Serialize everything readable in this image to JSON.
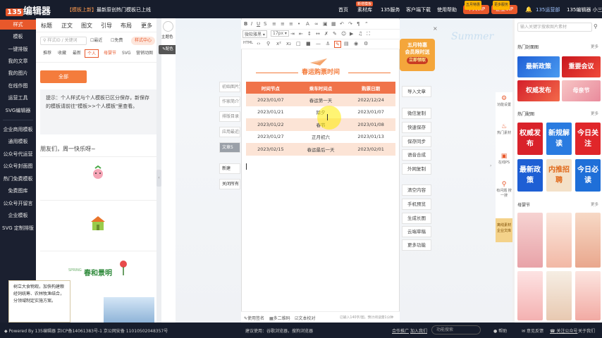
{
  "topbar": {
    "logo": "编辑器",
    "logo_prefix": "135",
    "notice_tag": "【模板上新】",
    "notice_text": "最新原创热门模板已上线",
    "nav": [
      "首页",
      "素材库",
      "135服务",
      "客户端下载",
      "使用帮助"
    ],
    "nav_badge": "新增模板",
    "vip_personal": "个人VIP",
    "vip_personal_tag": "五月特惠",
    "vip_enterprise": "企业VIP",
    "vip_enterprise_tag": "更多服务",
    "user_links": [
      "135运营部",
      "135编辑器 小三儿"
    ]
  },
  "leftnav": {
    "items": [
      "样式",
      "模板",
      "一键排版",
      "我的文章",
      "我的图片",
      "在线作图",
      "运营工具",
      "SVG编辑器",
      "企业商用模板",
      "通用模板",
      "公众号代运营",
      "公众号封面图",
      "热门免费模板",
      "免费图库",
      "公众号开留言",
      "企业模板",
      "SVG 定制排版"
    ],
    "active": 0
  },
  "panel": {
    "tabs": [
      "标题",
      "正文",
      "图文",
      "引导",
      "布局",
      "更多"
    ],
    "search_placeholder": "样式ID / 关键词",
    "chips": [
      "最近",
      "免费"
    ],
    "style_center": "样式中心",
    "subtabs": [
      "推荐",
      "收藏",
      "最新",
      "个人",
      "母婴节",
      "SVG",
      "营销动图"
    ],
    "active_subtab": "个人",
    "all_button": "全部",
    "tip": "提示：个人样式与个人模板已区分保存，新保存的模板请前往\"模板>>个人模板\"里查看。",
    "greeting": "朋友们，周一快乐呀~",
    "spring_text": "春和景明",
    "spring_small": "SPRING",
    "note_text": "树立大食物观，加快构建粮经饲统筹、农林牧渔结合，分领域制定实施方案。"
  },
  "sidetools": [
    "主题色",
    "配色"
  ],
  "editor": {
    "font_select": "微软雅黑",
    "font_size": "17px",
    "toolbar_label": "HTML",
    "table_title": "春运购票时间",
    "columns": [
      "时间节点",
      "乘车时间点",
      "购票日期"
    ],
    "rows": [
      [
        "2023/01/07",
        "春运第一天",
        "2022/12/24"
      ],
      [
        "2023/01/21",
        "除夕",
        "2023/01/07"
      ],
      [
        "2023/01/22",
        "春节",
        "2023/01/08"
      ],
      [
        "2023/01/27",
        "正月初六",
        "2023/01/13"
      ],
      [
        "2023/02/15",
        "春运最后一天",
        "2023/02/01"
      ]
    ],
    "bottom": [
      "使用签名",
      "多二维码",
      "文本校对"
    ],
    "status": "已输入140字/图，预计阅读需1分钟"
  },
  "left_floating": [
    "初始图片定位",
    "作家简介下方",
    "排版目录",
    "应用最近排版",
    "文章5",
    "新建",
    "关闭所有"
  ],
  "right_buttons": [
    "导入文章",
    "微信复制",
    "快速保存",
    "保存同步",
    "语音合成",
    "外网复制",
    "清空内容",
    "手机预览",
    "生成长图",
    "云端草稿",
    "更多功能"
  ],
  "promo": {
    "line1": "五月特惠",
    "line2": "会员限时送",
    "sub": "立即领取"
  },
  "summer": "Summer",
  "rtools": [
    "功能设置",
    "热门素材",
    "在线PS",
    "有问题 搜一搜",
    "离线素材 企业文库"
  ],
  "rpanel": {
    "search_placeholder": "输入关键字搜索图片素材",
    "sections": [
      "热门封面图",
      "热门配图",
      "母婴节"
    ],
    "more": "更多",
    "cover_labels": [
      "最新政策",
      "重要会议",
      "权威发布",
      "母亲节"
    ],
    "pic_labels": [
      "权威发布",
      "新规解读",
      "今日关注",
      "最新政策",
      "内推招聘",
      "今日必读"
    ]
  },
  "footer": {
    "left": "Powered By 135编辑器 京ICP备14061383号-1 京公网安备 11010502048357号",
    "mid": "建议使用：谷歌浏览器，搜狗浏览器",
    "links": [
      "合作推广",
      "加入我们"
    ],
    "search_placeholder": "功能搜索",
    "help": "帮助",
    "right": [
      "意见反馈",
      "关注公众号",
      "关于我们"
    ]
  },
  "colors": {
    "accent": "#e8582b",
    "table_header": "#f0734a",
    "table_stripe": "#fce4d6",
    "dark": "#171d2c"
  }
}
